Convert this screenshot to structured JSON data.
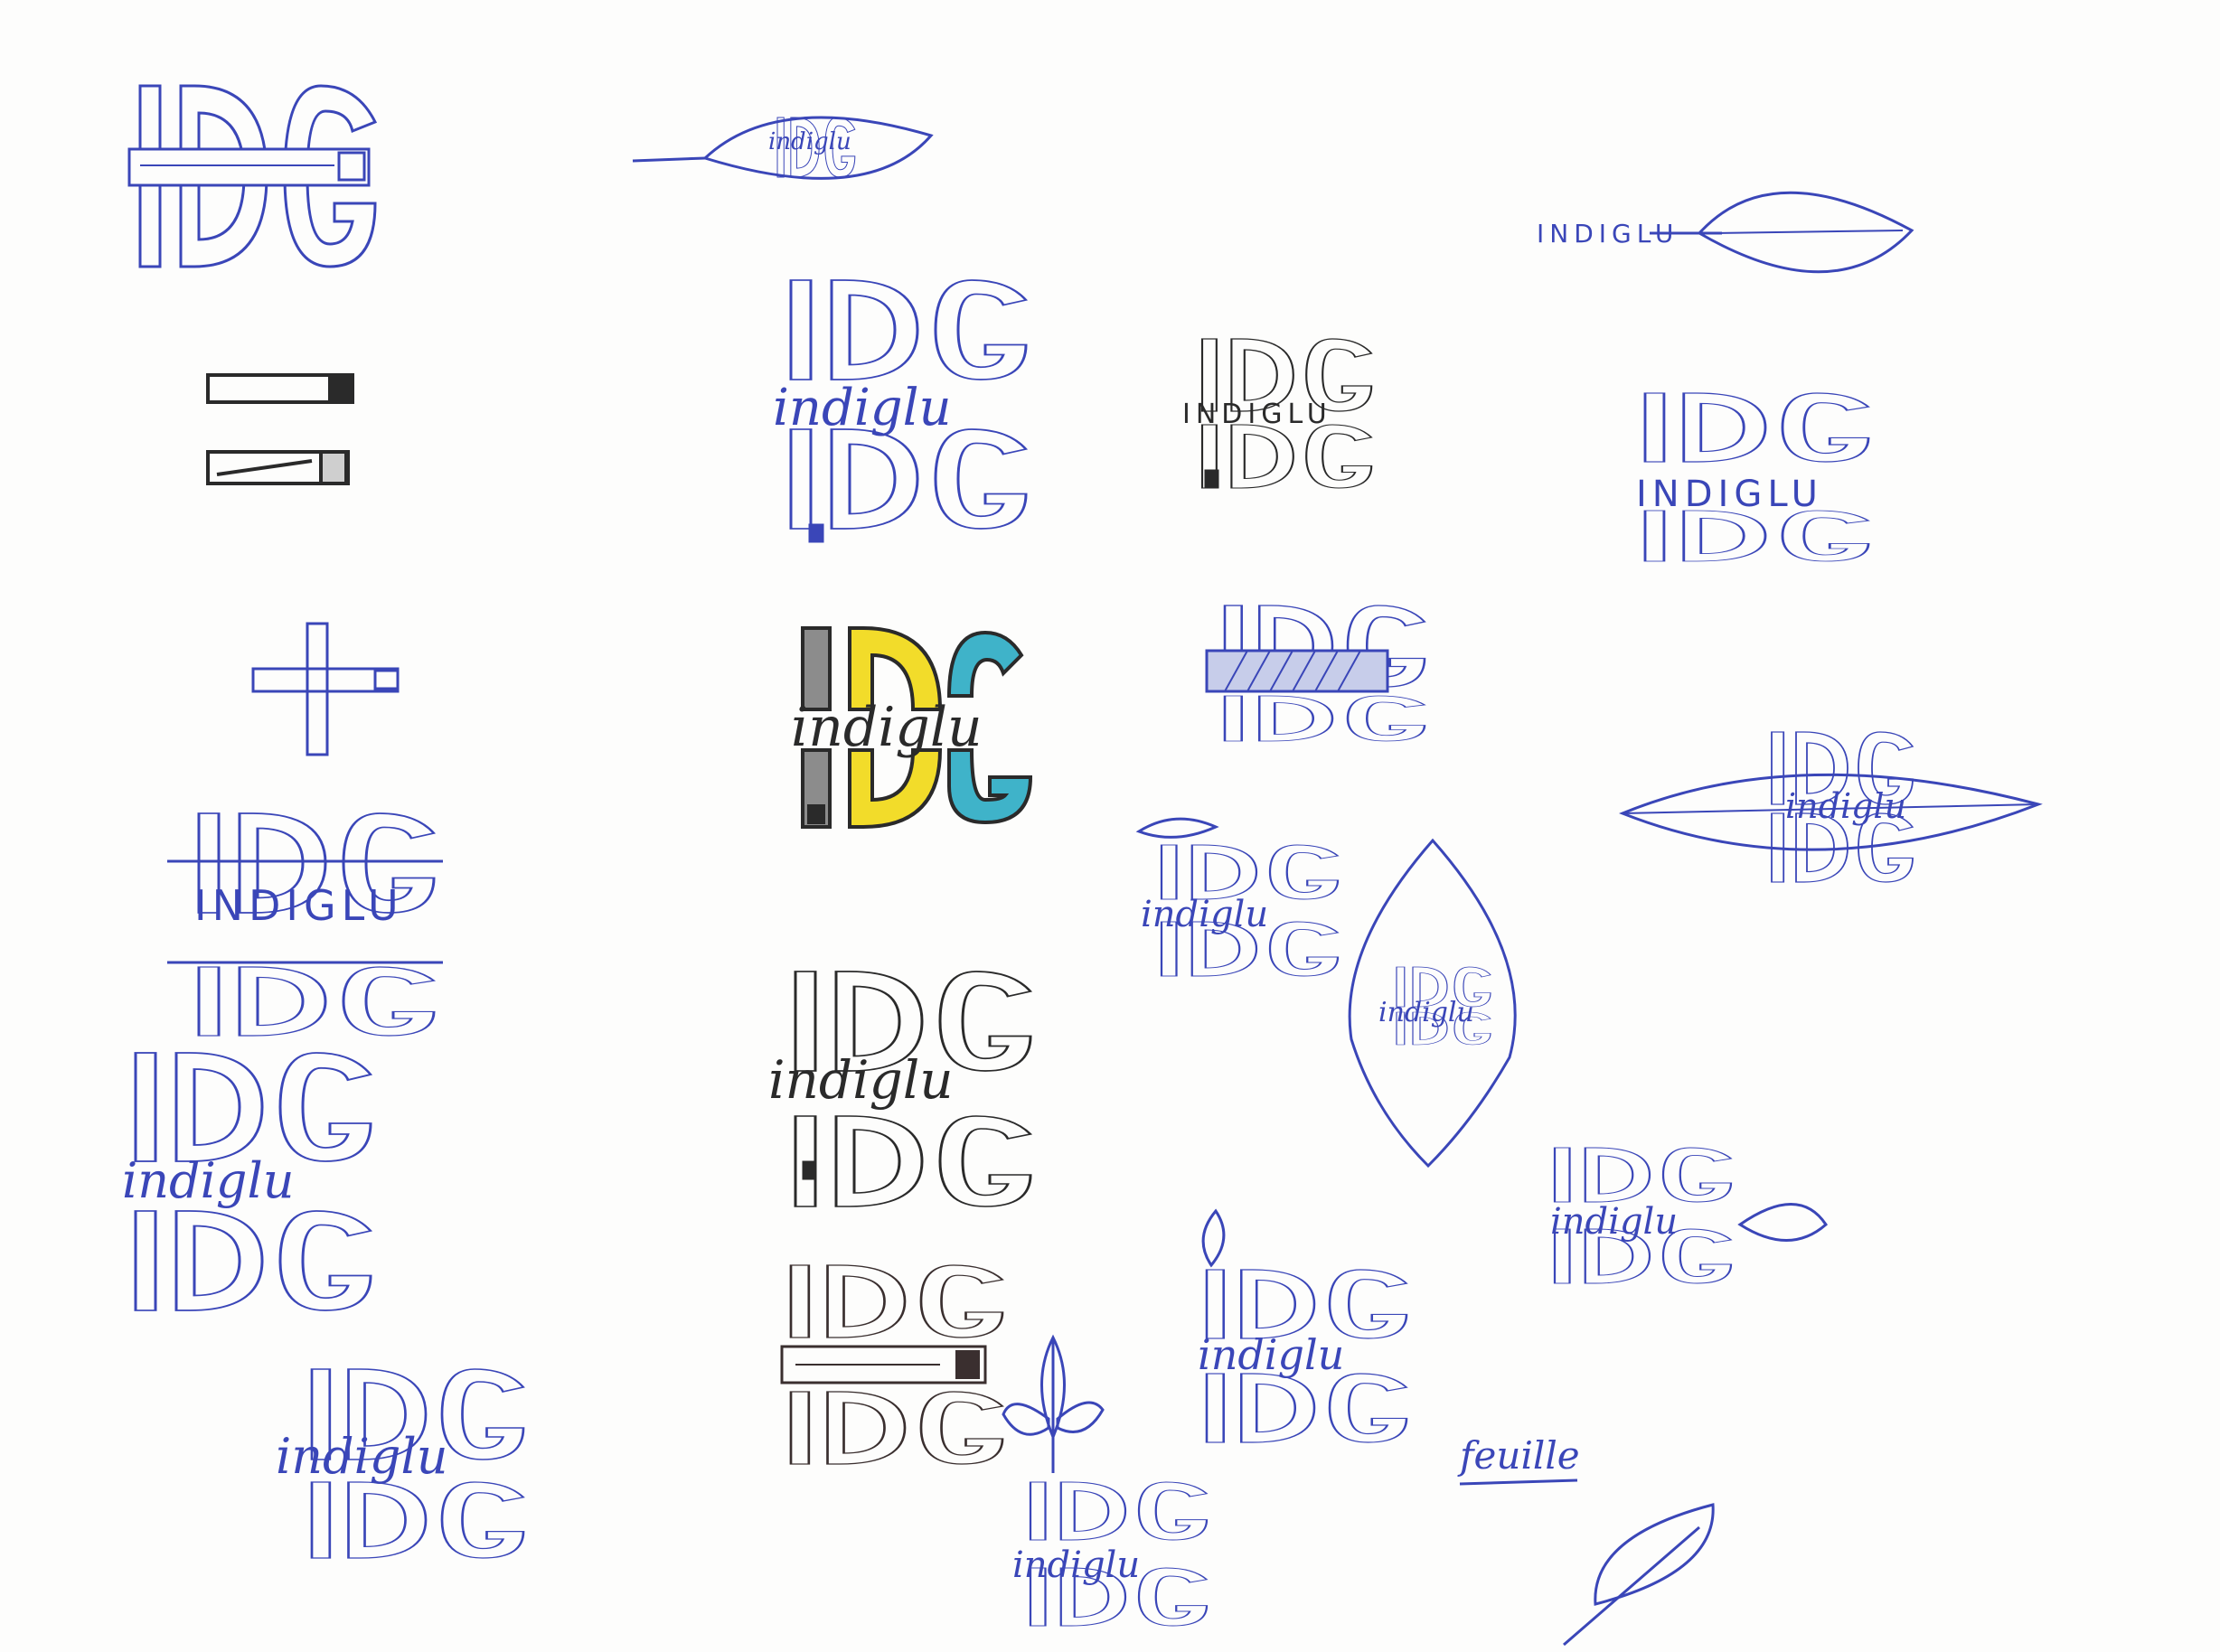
{
  "paper": {
    "background": "#fdfdfc",
    "ink_blue": "#3a46b8",
    "ink_black": "#2a2a2a",
    "marker_yellow": "#f2dc2a",
    "marker_teal": "#3fb3c9",
    "marker_gray": "#8c8c8c"
  },
  "sketches": {
    "monogram": "IDG",
    "script_word": "indiglu",
    "caps_word": "INDIGLU",
    "feuille_label": "feuille"
  },
  "icons": [
    "leaf-icon",
    "sprout-icon",
    "lighter-icon",
    "cross-icon"
  ]
}
